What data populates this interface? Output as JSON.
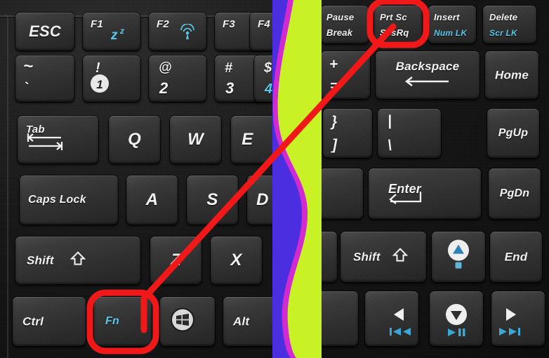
{
  "image": {
    "subject": "laptop-keyboard-closeup",
    "annotation_color": "#f01818",
    "annotation_note": "Red line connects the Fn key to the Prt Sc / SysRq key, both circled in red"
  },
  "stripe": {
    "name": "rainbow-color-bar",
    "colors": [
      "#4a2ee0",
      "#d02ad0",
      "#c8f225"
    ],
    "color_names": [
      "blue",
      "magenta",
      "yellow-green"
    ]
  },
  "highlights": [
    {
      "name": "fn-key-highlight",
      "target": "Fn",
      "color": "#f01818"
    },
    {
      "name": "prtsc-key-highlight",
      "target": "Prt Sc SysRq",
      "color": "#f01818"
    }
  ],
  "left_keyboard": {
    "rows": [
      {
        "name": "function-row",
        "keys": [
          {
            "id": "esc",
            "primary": "ESC",
            "secondary": "",
            "sec_color": ""
          },
          {
            "id": "f1",
            "primary": "F1",
            "secondary": "sleep-zzz-icon",
            "sec_color": "#59c8e8"
          },
          {
            "id": "f2",
            "primary": "F2",
            "secondary": "wireless-icon",
            "sec_color": "#59c8e8"
          },
          {
            "id": "f3",
            "primary": "F3",
            "secondary": "",
            "sec_color": ""
          },
          {
            "id": "f4",
            "primary": "F4",
            "secondary": "",
            "sec_color": ""
          }
        ]
      },
      {
        "name": "number-row",
        "keys": [
          {
            "id": "tilde",
            "primary": "~",
            "secondary": "`",
            "sec_color": ""
          },
          {
            "id": "one",
            "primary": "!",
            "secondary": "1",
            "sec_color": ""
          },
          {
            "id": "two",
            "primary": "@",
            "secondary": "2",
            "sec_color": ""
          },
          {
            "id": "three",
            "primary": "#",
            "secondary": "3",
            "sec_color": ""
          },
          {
            "id": "four",
            "primary": "$",
            "secondary": "4",
            "sec_color": "#59c8e8"
          }
        ]
      },
      {
        "name": "qwerty-row",
        "keys": [
          {
            "id": "tab",
            "primary": "Tab",
            "secondary": "tab-arrows-icon",
            "sec_color": ""
          },
          {
            "id": "q",
            "primary": "Q",
            "secondary": "",
            "sec_color": ""
          },
          {
            "id": "w",
            "primary": "W",
            "secondary": "",
            "sec_color": ""
          },
          {
            "id": "e",
            "primary": "E",
            "secondary": "",
            "sec_color": ""
          }
        ]
      },
      {
        "name": "home-row",
        "keys": [
          {
            "id": "capslock",
            "primary": "Caps Lock",
            "secondary": "",
            "sec_color": ""
          },
          {
            "id": "a",
            "primary": "A",
            "secondary": "",
            "sec_color": ""
          },
          {
            "id": "s",
            "primary": "S",
            "secondary": "",
            "sec_color": ""
          },
          {
            "id": "d",
            "primary": "D",
            "secondary": "",
            "sec_color": ""
          }
        ]
      },
      {
        "name": "shift-row",
        "keys": [
          {
            "id": "lshift",
            "primary": "Shift",
            "secondary": "shift-up-arrow-icon",
            "sec_color": ""
          },
          {
            "id": "z",
            "primary": "Z",
            "secondary": "",
            "sec_color": ""
          },
          {
            "id": "x",
            "primary": "X",
            "secondary": "",
            "sec_color": ""
          }
        ]
      },
      {
        "name": "modifier-row",
        "keys": [
          {
            "id": "ctrl",
            "primary": "Ctrl",
            "secondary": "",
            "sec_color": ""
          },
          {
            "id": "fn",
            "primary": "Fn",
            "secondary": "",
            "sec_color": "#59c8e8"
          },
          {
            "id": "win",
            "primary": "",
            "secondary": "windows-logo-icon",
            "sec_color": ""
          },
          {
            "id": "alt",
            "primary": "Alt",
            "secondary": "",
            "sec_color": ""
          }
        ]
      }
    ]
  },
  "right_keyboard": {
    "rows": [
      {
        "name": "function-row-right",
        "keys": [
          {
            "id": "pause",
            "primary": "Pause",
            "secondary": "Break",
            "sec_color": ""
          },
          {
            "id": "prtsc",
            "primary": "Prt Sc",
            "secondary": "SysRq",
            "sec_color": ""
          },
          {
            "id": "insert",
            "primary": "Insert",
            "secondary": "Num LK",
            "sec_color": "#59c8e8"
          },
          {
            "id": "delete",
            "primary": "Delete",
            "secondary": "Scr LK",
            "sec_color": "#59c8e8"
          }
        ]
      },
      {
        "name": "number-row-right",
        "keys": [
          {
            "id": "plus",
            "primary": "+",
            "secondary": "=",
            "sec_color": ""
          },
          {
            "id": "backspace",
            "primary": "Backspace",
            "secondary": "backspace-arrow-icon",
            "sec_color": ""
          },
          {
            "id": "home",
            "primary": "Home",
            "secondary": "",
            "sec_color": ""
          }
        ]
      },
      {
        "name": "qwerty-row-right",
        "keys": [
          {
            "id": "bracket",
            "primary": "}",
            "secondary": "]",
            "sec_color": ""
          },
          {
            "id": "pipe",
            "primary": "|",
            "secondary": "\\",
            "sec_color": ""
          },
          {
            "id": "pgup",
            "primary": "PgUp",
            "secondary": "",
            "sec_color": ""
          }
        ]
      },
      {
        "name": "home-row-right",
        "keys": [
          {
            "id": "quote",
            "primary": "",
            "secondary": "",
            "sec_color": ""
          },
          {
            "id": "enter",
            "primary": "Enter",
            "secondary": "enter-arrow-icon",
            "sec_color": ""
          },
          {
            "id": "pgdn",
            "primary": "PgDn",
            "secondary": "",
            "sec_color": ""
          }
        ]
      },
      {
        "name": "shift-row-right",
        "keys": [
          {
            "id": "slash",
            "primary": "",
            "secondary": "",
            "sec_color": ""
          },
          {
            "id": "rshift",
            "primary": "Shift",
            "secondary": "shift-up-arrow-icon",
            "sec_color": ""
          },
          {
            "id": "up",
            "primary": "",
            "secondary": "arrow-up-icon",
            "sec_color": "#59c8e8"
          },
          {
            "id": "end",
            "primary": "End",
            "secondary": "",
            "sec_color": ""
          }
        ]
      },
      {
        "name": "arrow-row",
        "keys": [
          {
            "id": "ralt",
            "primary": "",
            "secondary": "",
            "sec_color": ""
          },
          {
            "id": "left",
            "primary": "",
            "secondary": "arrow-left-icon",
            "media": "prev-track-icon",
            "sec_color": "#2a9fd0"
          },
          {
            "id": "down",
            "primary": "",
            "secondary": "arrow-down-icon",
            "media": "play-pause-icon",
            "sec_color": "#2a9fd0"
          },
          {
            "id": "right",
            "primary": "",
            "secondary": "arrow-right-icon",
            "media": "next-track-icon",
            "sec_color": "#2a9fd0"
          }
        ]
      }
    ]
  }
}
